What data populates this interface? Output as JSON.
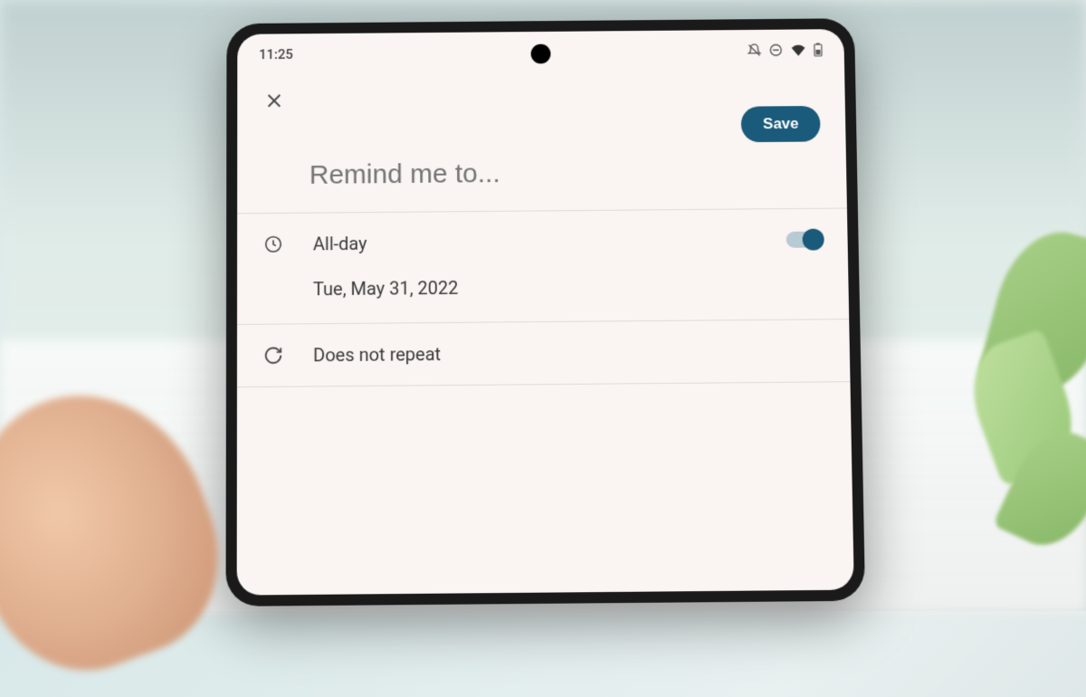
{
  "status": {
    "time": "11:25"
  },
  "header": {
    "save_label": "Save"
  },
  "reminder": {
    "title_placeholder": "Remind me to...",
    "all_day_label": "All-day",
    "all_day_on": true,
    "date_label": "Tue, May 31, 2022",
    "repeat_label": "Does not repeat"
  },
  "colors": {
    "accent": "#1a5a7a",
    "screen_bg": "#faf4f2"
  }
}
